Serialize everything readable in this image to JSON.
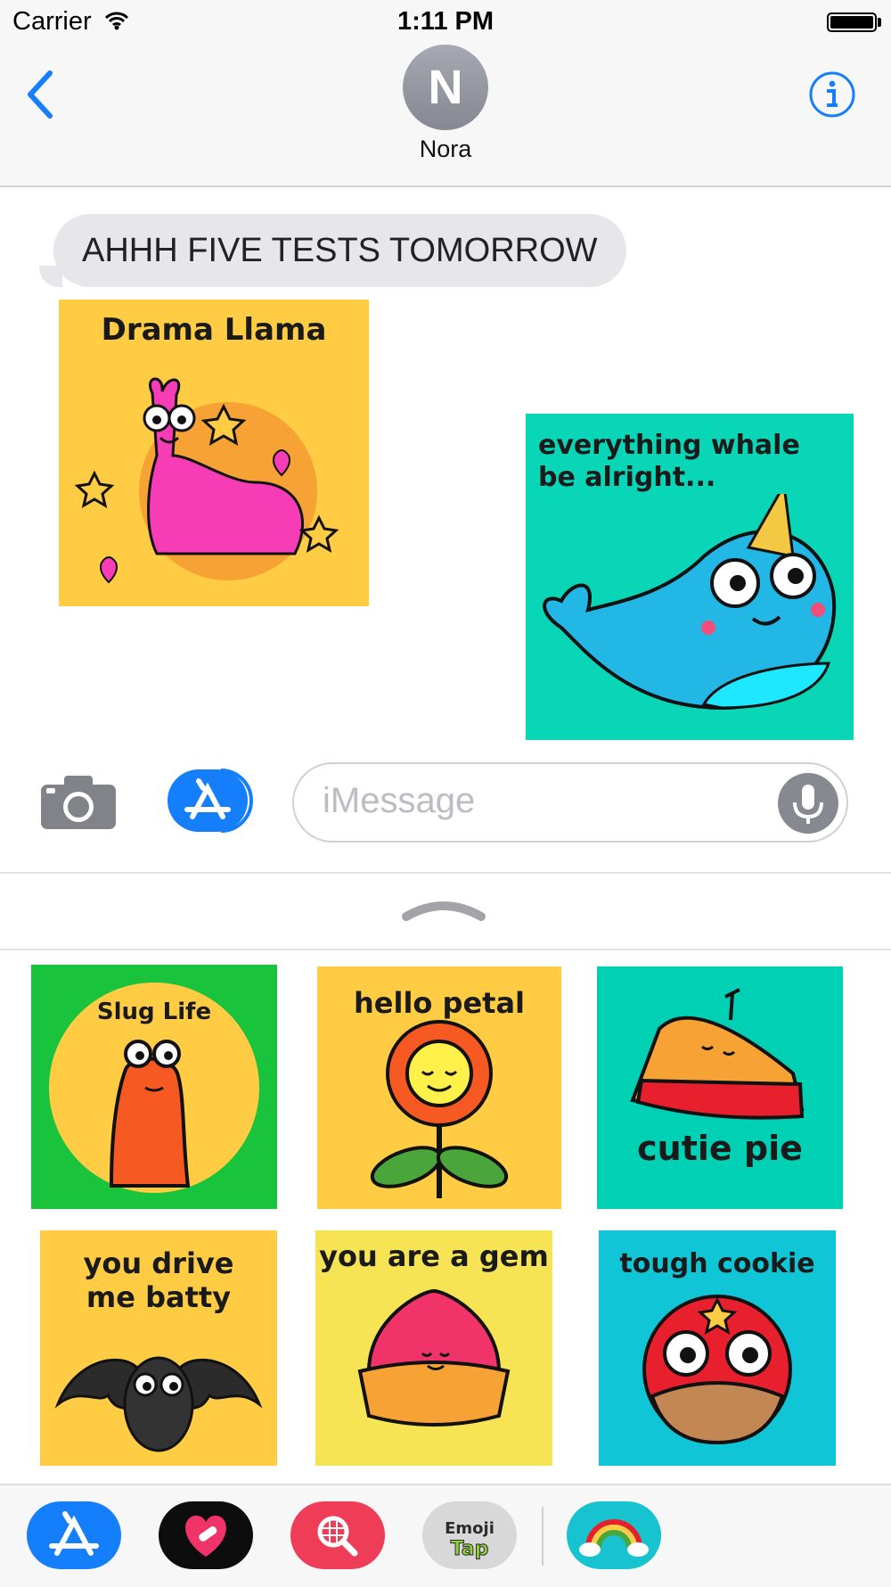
{
  "status_bar": {
    "carrier": "Carrier",
    "time": "1:11 PM"
  },
  "header": {
    "avatar_initial": "N",
    "contact_name": "Nora"
  },
  "messages": [
    {
      "type": "text",
      "from": "received",
      "text": "AHHH FIVE TESTS TOMORROW"
    },
    {
      "type": "sticker",
      "from": "received",
      "caption": "Drama Llama"
    },
    {
      "type": "sticker",
      "from": "received",
      "caption": "everything whale be alright..."
    }
  ],
  "composer": {
    "placeholder": "iMessage"
  },
  "sticker_tray": [
    {
      "caption": "Slug Life",
      "bg": "#19c33c"
    },
    {
      "caption": "hello petal",
      "bg": "#ffcc44"
    },
    {
      "caption": "cutie pie",
      "bg": "#00d1b4"
    },
    {
      "caption": "you drive me batty",
      "bg": "#ffcc44"
    },
    {
      "caption": "you are a gem",
      "bg": "#f6e454"
    },
    {
      "caption": "tough cookie",
      "bg": "#10c6d6"
    }
  ],
  "app_drawer": [
    {
      "icon": "app-store-icon"
    },
    {
      "icon": "heart-sticker-app-icon"
    },
    {
      "icon": "search-images-app-icon"
    },
    {
      "icon": "emoji-tap-app-icon",
      "label": "Emoji Tap"
    },
    {
      "icon": "rainbow-app-icon"
    }
  ],
  "colors": {
    "ios_blue": "#157efb",
    "bubble_gray": "#e6e6eb",
    "nav_bg": "#f7f7f7"
  }
}
